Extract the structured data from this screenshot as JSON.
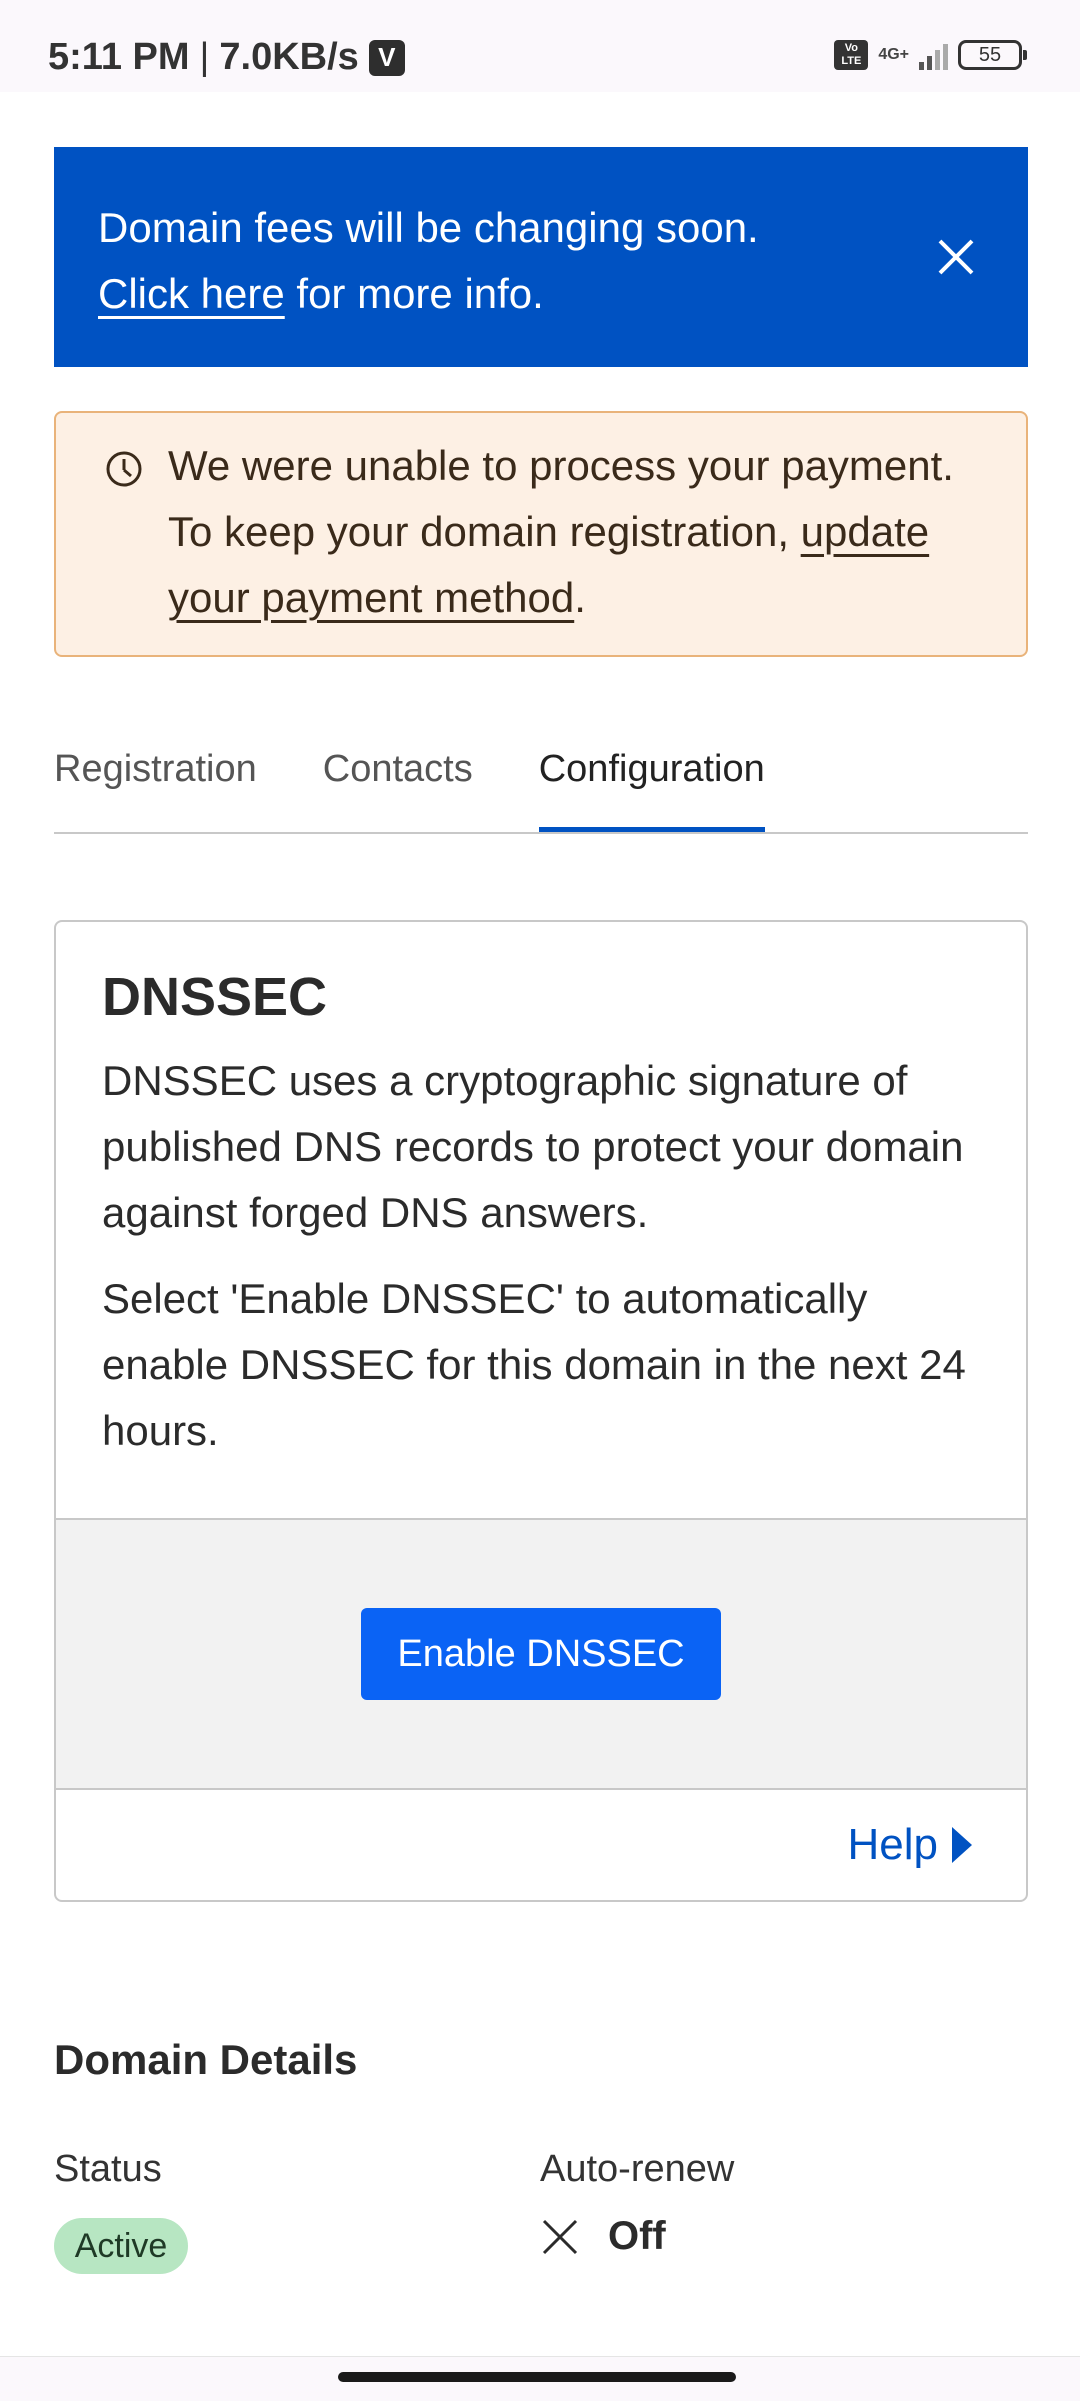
{
  "status_bar": {
    "time": "5:11 PM",
    "separator": "|",
    "speed": "7.0KB/s",
    "badge": "V",
    "volte": "Vo LTE",
    "network": "4G+",
    "battery": "55"
  },
  "banner": {
    "line1": "Domain fees will be changing soon.",
    "link": "Click here",
    "line2_rest": " for more info.",
    "close_icon": "close-icon"
  },
  "warning": {
    "icon": "clock-icon",
    "text_before": "We were unable to process your payment. To keep your domain registration, ",
    "link": "update your payment method",
    "text_after": "."
  },
  "tabs": [
    {
      "label": "Registration",
      "active": false
    },
    {
      "label": "Contacts",
      "active": false
    },
    {
      "label": "Configuration",
      "active": true
    }
  ],
  "dnssec": {
    "title": "DNSSEC",
    "paragraph1": "DNSSEC uses a cryptographic signature of published DNS records to protect your domain against forged DNS answers.",
    "paragraph2": "Select 'Enable DNSSEC' to automatically enable DNSSEC for this domain in the next 24 hours.",
    "button": "Enable DNSSEC",
    "help": "Help"
  },
  "domain_details": {
    "title": "Domain Details",
    "status_label": "Status",
    "status_value": "Active",
    "autorenew_label": "Auto-renew",
    "autorenew_value": "Off"
  },
  "colors": {
    "banner_bg": "#0052c2",
    "warning_bg": "#fdf0e4",
    "warning_border": "#e9b37a",
    "button_bg": "#0a63f5",
    "badge_bg": "#b7e6c2"
  }
}
